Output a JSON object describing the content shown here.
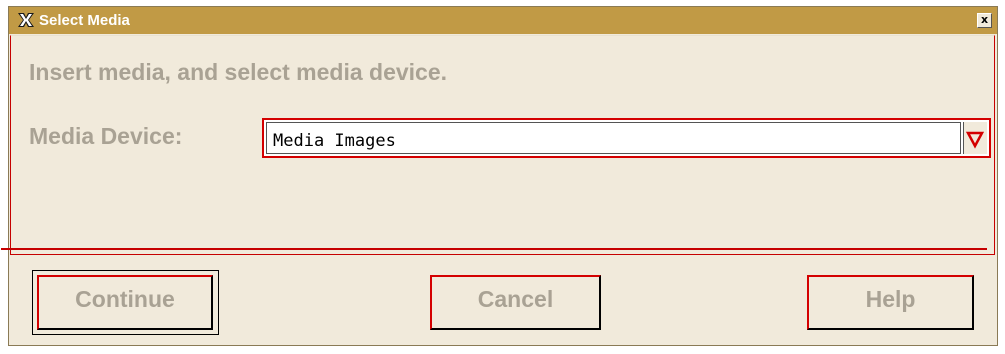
{
  "window": {
    "title": "Select Media",
    "close_glyph": "x"
  },
  "dialog": {
    "instruction": "Insert media, and select media device.",
    "device_label": "Media Device:",
    "device_value": "Media Images"
  },
  "buttons": {
    "continue": "Continue",
    "cancel": "Cancel",
    "help": "Help"
  },
  "icons": {
    "app": "x-logo-icon",
    "dropdown": "triangle-down-icon",
    "close": "close-icon"
  },
  "colors": {
    "titlebar": "#c19a45",
    "background": "#f1eadb",
    "accent_red": "#d40000",
    "disabled_text": "#a9a294"
  }
}
